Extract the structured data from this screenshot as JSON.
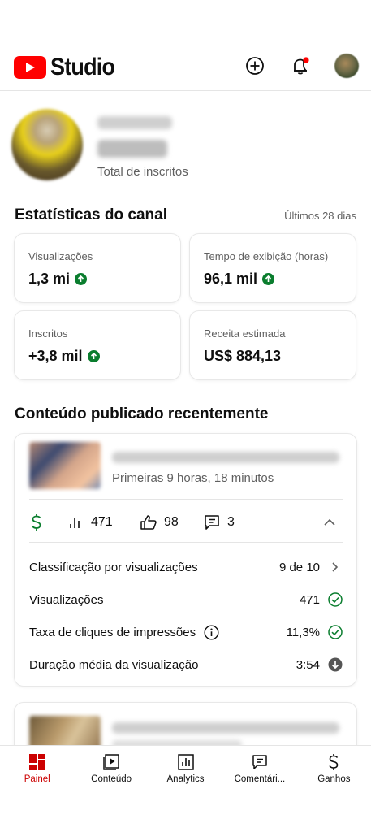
{
  "app": {
    "logo_text": "Studio",
    "brand_red": "#ff0000"
  },
  "channel": {
    "subscribers_label": "Total de inscritos"
  },
  "stats": {
    "title": "Estatísticas do canal",
    "period": "Últimos 28 dias",
    "cards": [
      {
        "label": "Visualizações",
        "value": "1,3 mi",
        "trend": "up"
      },
      {
        "label": "Tempo de exibição (horas)",
        "value": "96,1 mil",
        "trend": "up"
      },
      {
        "label": "Inscritos",
        "value": "+3,8 mil",
        "trend": "up"
      },
      {
        "label": "Receita estimada",
        "value": "US$ 884,13",
        "trend": "none"
      }
    ]
  },
  "recent": {
    "title": "Conteúdo publicado recentemente",
    "video": {
      "subtitle": "Primeiras 9 horas, 18 minutos",
      "views": "471",
      "likes": "98",
      "comments": "3",
      "details": [
        {
          "label": "Classificação por visualizações",
          "value": "9 de 10",
          "icon": "chevron-right-icon"
        },
        {
          "label": "Visualizações",
          "value": "471",
          "icon": "check-circle-icon"
        },
        {
          "label": "Taxa de cliques de impressões",
          "value": "11,3%",
          "icon": "check-circle-icon"
        },
        {
          "label": "Duração média da visualização",
          "value": "3:54",
          "icon": "down-arrow-circle-icon"
        }
      ]
    }
  },
  "nav": {
    "items": [
      {
        "label": "Painel",
        "icon": "dashboard-icon",
        "active": true
      },
      {
        "label": "Conteúdo",
        "icon": "content-icon",
        "active": false
      },
      {
        "label": "Analytics",
        "icon": "analytics-icon",
        "active": false
      },
      {
        "label": "Comentári...",
        "icon": "comments-icon",
        "active": false
      },
      {
        "label": "Ganhos",
        "icon": "dollar-icon",
        "active": false
      }
    ]
  },
  "colors": {
    "accent_red": "#cc0000",
    "positive_green": "#0a7d2e",
    "text_secondary": "#606060"
  }
}
